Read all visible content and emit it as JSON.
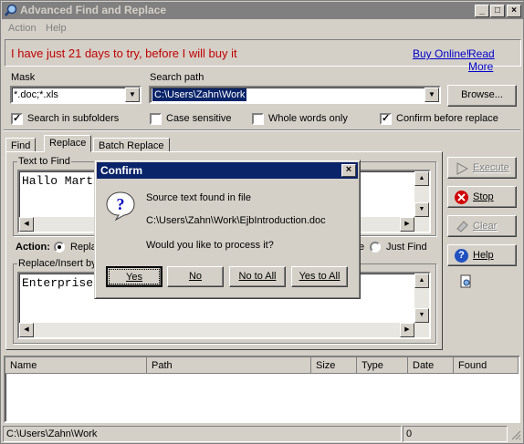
{
  "window": {
    "title": "Advanced Find and Replace"
  },
  "menu": [
    "Action",
    "Help"
  ],
  "banner": {
    "message": "I have just 21 days to try, before I will buy it",
    "buy_online": "Buy Online!",
    "read_more": "Read More"
  },
  "mask": {
    "label": "Mask",
    "value": "*.doc;*.xls"
  },
  "search_path": {
    "label": "Search path",
    "value": "C:\\Users\\Zahn\\Work",
    "browse_label": "Browse..."
  },
  "options": {
    "search_subfolders": {
      "label": "Search in subfolders",
      "checked": true
    },
    "case_sensitive": {
      "label": "Case sensitive",
      "checked": false
    },
    "whole_words": {
      "label": "Whole words only",
      "checked": false
    },
    "confirm_replace": {
      "label": "Confirm before replace",
      "checked": true
    }
  },
  "tabs": [
    "Find",
    "Replace",
    "Batch Replace"
  ],
  "active_tab": "Replace",
  "text_to_find": {
    "label": "Text to Find",
    "value": "Hallo Martin"
  },
  "action": {
    "label": "Action:",
    "option_replace": "Repla",
    "option_just_find": "Just Find",
    "fragment_e": "e"
  },
  "replace_insert": {
    "label": "Replace/Insert by",
    "value": "Enterprise Ja"
  },
  "side_buttons": {
    "execute": "Execute",
    "stop": "Stop",
    "clear": "Clear",
    "help": "Help"
  },
  "results_table": {
    "columns": [
      "Name",
      "Path",
      "Size",
      "Type",
      "Date",
      "Found"
    ],
    "rows": []
  },
  "status_bar": {
    "path": "C:\\Users\\Zahn\\Work",
    "count": "0"
  },
  "dialog": {
    "title": "Confirm",
    "line1": "Source text found in file",
    "line2": "C:\\Users\\Zahn\\Work\\EjbIntroduction.doc",
    "line3": "Would you like to process it?",
    "buttons": {
      "yes": "Yes",
      "no": "No",
      "no_to_all": "No to All",
      "yes_to_all": "Yes to All"
    }
  },
  "colors": {
    "title_inactive": "#808080",
    "dialog_title": "#0a246a",
    "banner_text": "#c00000",
    "link": "#0000cc",
    "face": "#d4d0c8"
  }
}
